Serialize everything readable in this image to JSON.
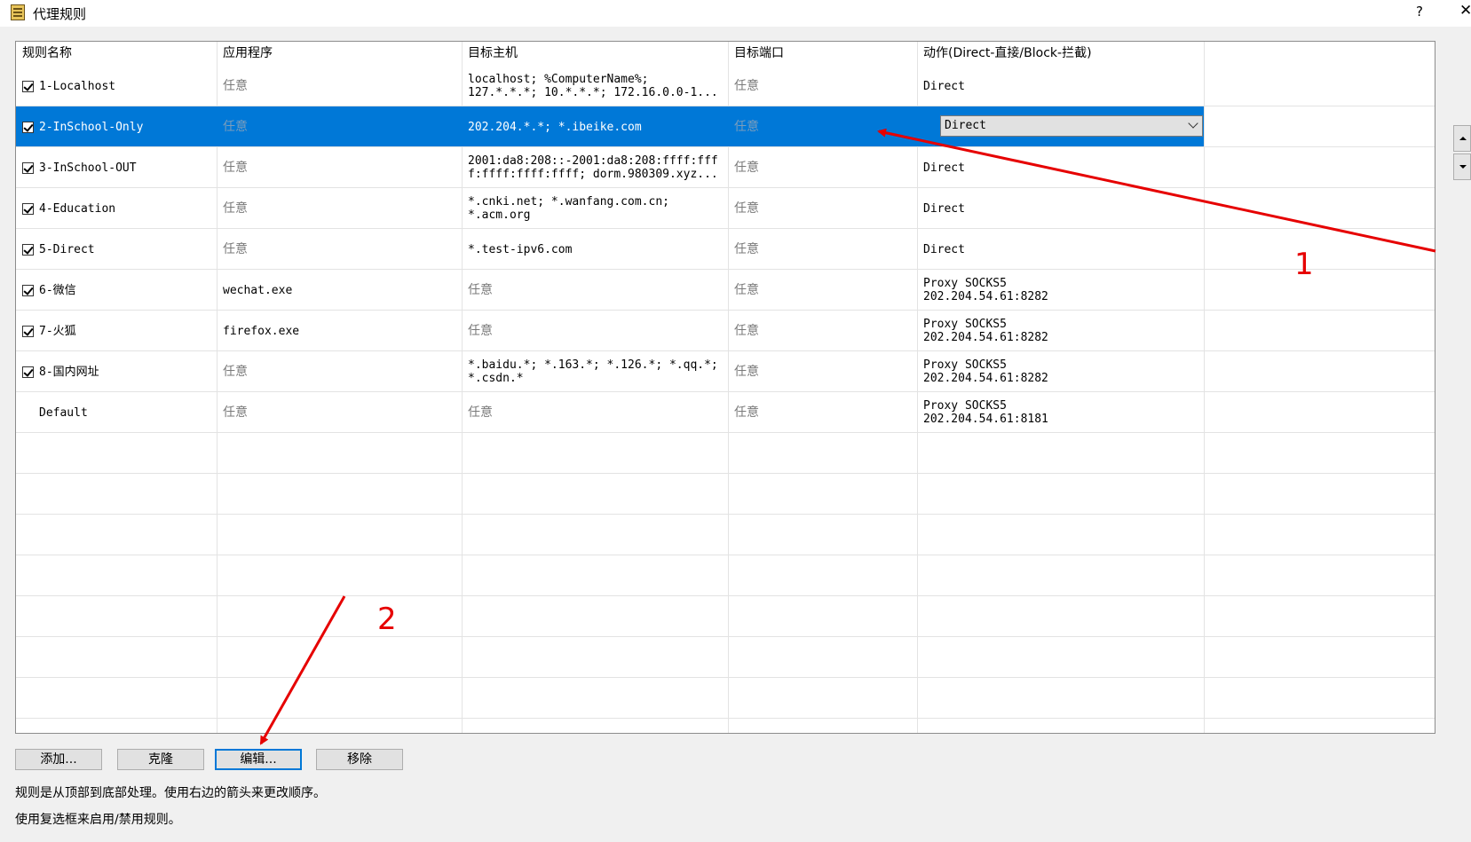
{
  "window": {
    "title": "代理规则",
    "help_label": "?",
    "close_label": "✕"
  },
  "columns": [
    "规则名称",
    "应用程序",
    "目标主机",
    "目标端口",
    "动作(Direct-直接/Block-拦截)"
  ],
  "rules": [
    {
      "name": "1-Localhost",
      "checked": true,
      "has_checkbox": true,
      "app": "任意",
      "host": "localhost; %ComputerName%;\n127.*.*.*; 10.*.*.*; 172.16.0.0-1...",
      "port": "任意",
      "action": "Direct"
    },
    {
      "name": "2-InSchool-Only",
      "checked": true,
      "has_checkbox": true,
      "app": "任意",
      "host": "202.204.*.*; *.ibeike.com",
      "port": "任意",
      "action": "Direct",
      "selected": true
    },
    {
      "name": "3-InSchool-OUT",
      "checked": true,
      "has_checkbox": true,
      "app": "任意",
      "host": "2001:da8:208::-2001:da8:208:ffff:fff\nf:ffff:ffff:ffff; dorm.980309.xyz...",
      "port": "任意",
      "action": "Direct"
    },
    {
      "name": "4-Education",
      "checked": true,
      "has_checkbox": true,
      "app": "任意",
      "host": "*.cnki.net; *.wanfang.com.cn;\n*.acm.org",
      "port": "任意",
      "action": "Direct"
    },
    {
      "name": "5-Direct",
      "checked": true,
      "has_checkbox": true,
      "app": "任意",
      "host": "*.test-ipv6.com",
      "port": "任意",
      "action": "Direct"
    },
    {
      "name": "6-微信",
      "checked": true,
      "has_checkbox": true,
      "app": "wechat.exe",
      "host": "任意",
      "port": "任意",
      "action": "Proxy SOCKS5\n202.204.54.61:8282"
    },
    {
      "name": "7-火狐",
      "checked": true,
      "has_checkbox": true,
      "app": "firefox.exe",
      "host": "任意",
      "port": "任意",
      "action": "Proxy SOCKS5\n202.204.54.61:8282"
    },
    {
      "name": "8-国内网址",
      "checked": true,
      "has_checkbox": true,
      "app": "任意",
      "host": "*.baidu.*; *.163.*; *.126.*; *.qq.*;\n*.csdn.*",
      "port": "任意",
      "action": "Proxy SOCKS5\n202.204.54.61:8282"
    },
    {
      "name": "Default",
      "checked": false,
      "has_checkbox": false,
      "app": "任意",
      "host": "任意",
      "port": "任意",
      "action": "Proxy SOCKS5\n202.204.54.61:8181"
    }
  ],
  "selected_action_value": "Direct",
  "buttons": {
    "add": "添加...",
    "clone": "克隆",
    "edit": "编辑...",
    "remove": "移除"
  },
  "hints": [
    "规则是从顶部到底部处理。使用右边的箭头来更改顺序。",
    "使用复选框来启用/禁用规则。"
  ],
  "annotations": {
    "label_1": "1",
    "label_2": "2",
    "color": "#e60000"
  },
  "icons": {
    "title": "proxy-rules-icon",
    "move_up": "arrow-up-icon",
    "move_down": "arrow-down-icon"
  }
}
